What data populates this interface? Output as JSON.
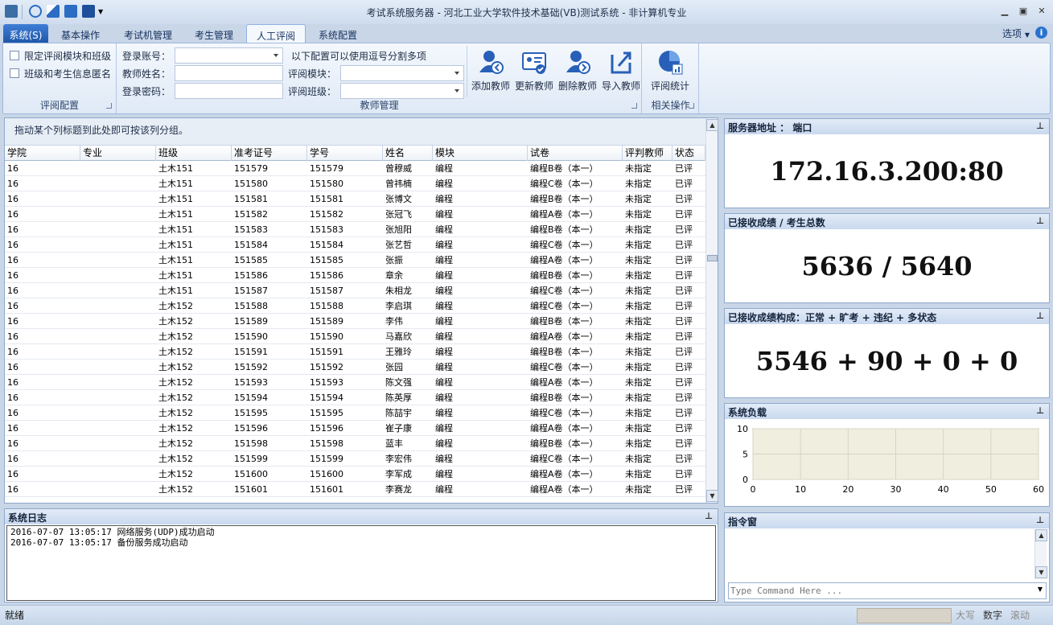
{
  "window": {
    "title": "考试系统服务器 - 河北工业大学软件技术基础(VB)测试系统 - 非计算机专业"
  },
  "quick_access": [
    "app-icon",
    "refresh-icon",
    "export-icon",
    "toolbar-icon",
    "edit-icon"
  ],
  "tabs": {
    "system": "系统(S)",
    "items": [
      "基本操作",
      "考试机管理",
      "考生管理",
      "人工评阅",
      "系统配置"
    ],
    "active": "人工评阅",
    "options": "选项",
    "help": "i"
  },
  "ribbon": {
    "review_config": {
      "label": "评阅配置",
      "cb1": "限定评阅模块和班级",
      "cb2": "班级和考生信息匿名"
    },
    "teacher_mgmt": {
      "label": "教师管理",
      "account": "登录账号：",
      "name": "教师姓名：",
      "password": "登录密码：",
      "hint": "以下配置可以使用逗号分割多项",
      "module": "评阅模块：",
      "class": "评阅班级："
    },
    "buttons": [
      "添加教师",
      "更新教师",
      "删除教师",
      "导入教师"
    ],
    "related": {
      "label": "相关操作",
      "stat": "评阅统计"
    }
  },
  "grid": {
    "group_hint": "拖动某个列标题到此处即可按该列分组。",
    "columns": [
      "学院",
      "专业",
      "班级",
      "准考证号",
      "学号",
      "姓名",
      "模块",
      "试卷",
      "评判教师",
      "状态"
    ],
    "rows": [
      [
        "16",
        "",
        "土木151",
        "151579",
        "151579",
        "曾穆威",
        "编程",
        "编程B卷（本一）",
        "未指定",
        "已评"
      ],
      [
        "16",
        "",
        "土木151",
        "151580",
        "151580",
        "曾祎楠",
        "编程",
        "编程C卷（本一）",
        "未指定",
        "已评"
      ],
      [
        "16",
        "",
        "土木151",
        "151581",
        "151581",
        "张博文",
        "编程",
        "编程B卷（本一）",
        "未指定",
        "已评"
      ],
      [
        "16",
        "",
        "土木151",
        "151582",
        "151582",
        "张冠飞",
        "编程",
        "编程A卷（本一）",
        "未指定",
        "已评"
      ],
      [
        "16",
        "",
        "土木151",
        "151583",
        "151583",
        "张旭阳",
        "编程",
        "编程B卷（本一）",
        "未指定",
        "已评"
      ],
      [
        "16",
        "",
        "土木151",
        "151584",
        "151584",
        "张艺哲",
        "编程",
        "编程C卷（本一）",
        "未指定",
        "已评"
      ],
      [
        "16",
        "",
        "土木151",
        "151585",
        "151585",
        "张振",
        "编程",
        "编程A卷（本一）",
        "未指定",
        "已评"
      ],
      [
        "16",
        "",
        "土木151",
        "151586",
        "151586",
        "章余",
        "编程",
        "编程B卷（本一）",
        "未指定",
        "已评"
      ],
      [
        "16",
        "",
        "土木151",
        "151587",
        "151587",
        "朱相龙",
        "编程",
        "编程C卷（本一）",
        "未指定",
        "已评"
      ],
      [
        "16",
        "",
        "土木152",
        "151588",
        "151588",
        "李启琪",
        "编程",
        "编程C卷（本一）",
        "未指定",
        "已评"
      ],
      [
        "16",
        "",
        "土木152",
        "151589",
        "151589",
        "李伟",
        "编程",
        "编程B卷（本一）",
        "未指定",
        "已评"
      ],
      [
        "16",
        "",
        "土木152",
        "151590",
        "151590",
        "马嘉欣",
        "编程",
        "编程A卷（本一）",
        "未指定",
        "已评"
      ],
      [
        "16",
        "",
        "土木152",
        "151591",
        "151591",
        "王雅玲",
        "编程",
        "编程B卷（本一）",
        "未指定",
        "已评"
      ],
      [
        "16",
        "",
        "土木152",
        "151592",
        "151592",
        "张园",
        "编程",
        "编程C卷（本一）",
        "未指定",
        "已评"
      ],
      [
        "16",
        "",
        "土木152",
        "151593",
        "151593",
        "陈文强",
        "编程",
        "编程A卷（本一）",
        "未指定",
        "已评"
      ],
      [
        "16",
        "",
        "土木152",
        "151594",
        "151594",
        "陈英厚",
        "编程",
        "编程B卷（本一）",
        "未指定",
        "已评"
      ],
      [
        "16",
        "",
        "土木152",
        "151595",
        "151595",
        "陈喆宇",
        "编程",
        "编程C卷（本一）",
        "未指定",
        "已评"
      ],
      [
        "16",
        "",
        "土木152",
        "151596",
        "151596",
        "崔子康",
        "编程",
        "编程A卷（本一）",
        "未指定",
        "已评"
      ],
      [
        "16",
        "",
        "土木152",
        "151598",
        "151598",
        "蓝丰",
        "编程",
        "编程B卷（本一）",
        "未指定",
        "已评"
      ],
      [
        "16",
        "",
        "土木152",
        "151599",
        "151599",
        "李宏伟",
        "编程",
        "编程C卷（本一）",
        "未指定",
        "已评"
      ],
      [
        "16",
        "",
        "土木152",
        "151600",
        "151600",
        "李军成",
        "编程",
        "编程A卷（本一）",
        "未指定",
        "已评"
      ],
      [
        "16",
        "",
        "土木152",
        "151601",
        "151601",
        "李赛龙",
        "编程",
        "编程A卷（本一）",
        "未指定",
        "已评"
      ]
    ]
  },
  "panels": {
    "server": {
      "title": "服务器地址 ： 端口",
      "value": "172.16.3.200:80"
    },
    "received": {
      "title": "已接收成绩 / 考生总数",
      "value": "5636 / 5640"
    },
    "composition": {
      "title": "已接收成绩构成：正常 + 旷考 + 违纪 + 多状态",
      "value": "5546 + 90 + 0 + 0"
    },
    "load": {
      "title": "系统负载"
    },
    "command": {
      "title": "指令窗",
      "placeholder": "Type Command Here ..."
    }
  },
  "chart_data": {
    "type": "line",
    "title": "系统负载",
    "x": [],
    "values": [],
    "xlim": [
      0,
      60
    ],
    "ylim": [
      0,
      10
    ],
    "xticks": [
      0,
      10,
      20,
      30,
      40,
      50,
      60
    ],
    "yticks": [
      0,
      5,
      10
    ],
    "grid": true
  },
  "log": {
    "title": "系统日志",
    "lines": [
      "2016-07-07 13:05:17 网络服务(UDP)成功启动",
      "2016-07-07 13:05:17 备份服务成功启动"
    ]
  },
  "statusbar": {
    "left": "就绪",
    "caps": "大写",
    "num": "数字",
    "scroll": "滚动"
  },
  "colors": {
    "accent": "#1e56a8",
    "panel_header": "#c9d9ee",
    "chart_bg": "#f0efdf"
  }
}
